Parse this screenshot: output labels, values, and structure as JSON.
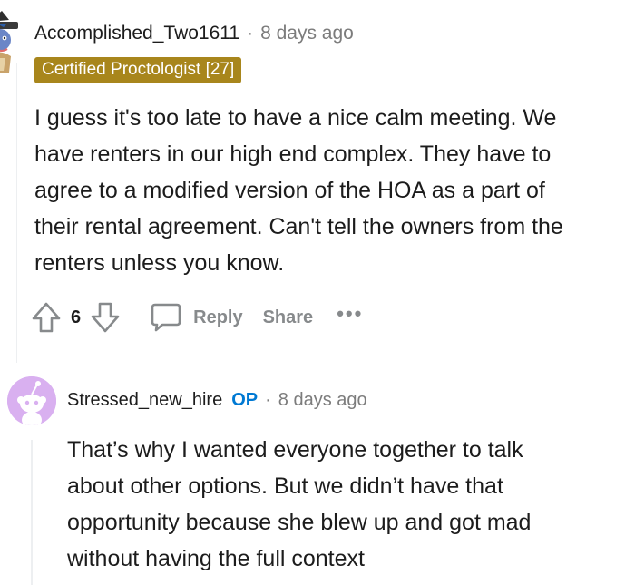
{
  "comments": [
    {
      "username": "Accomplished_Two1611",
      "separator": "·",
      "timestamp": "8 days ago",
      "flair": "Certified Proctologist [27]",
      "flair_color": "#a8861c",
      "body_lines": [
        "I guess it's too late to have a nice calm meeting. We",
        "have renters in our high end complex. They have to",
        "agree to a modified version of the HOA as a part of",
        "their rental agreement. Can't tell the owners from the",
        "renters unless you know."
      ],
      "vote_count": "6",
      "actions": {
        "reply": "Reply",
        "share": "Share",
        "more": "•••"
      },
      "avatar": "cartoon-avatar-with-hat"
    },
    {
      "username": "Stressed_new_hire",
      "op_badge": "OP",
      "op_color": "#0079d3",
      "separator": "·",
      "timestamp": "8 days ago",
      "body_lines": [
        "That’s why I wanted everyone together to talk",
        "about other options. But we didn’t have that",
        "opportunity because she blew up and got mad",
        "without having the full context"
      ],
      "avatar": "default-snoo-avatar",
      "avatar_color": "#d9b0f0"
    }
  ]
}
